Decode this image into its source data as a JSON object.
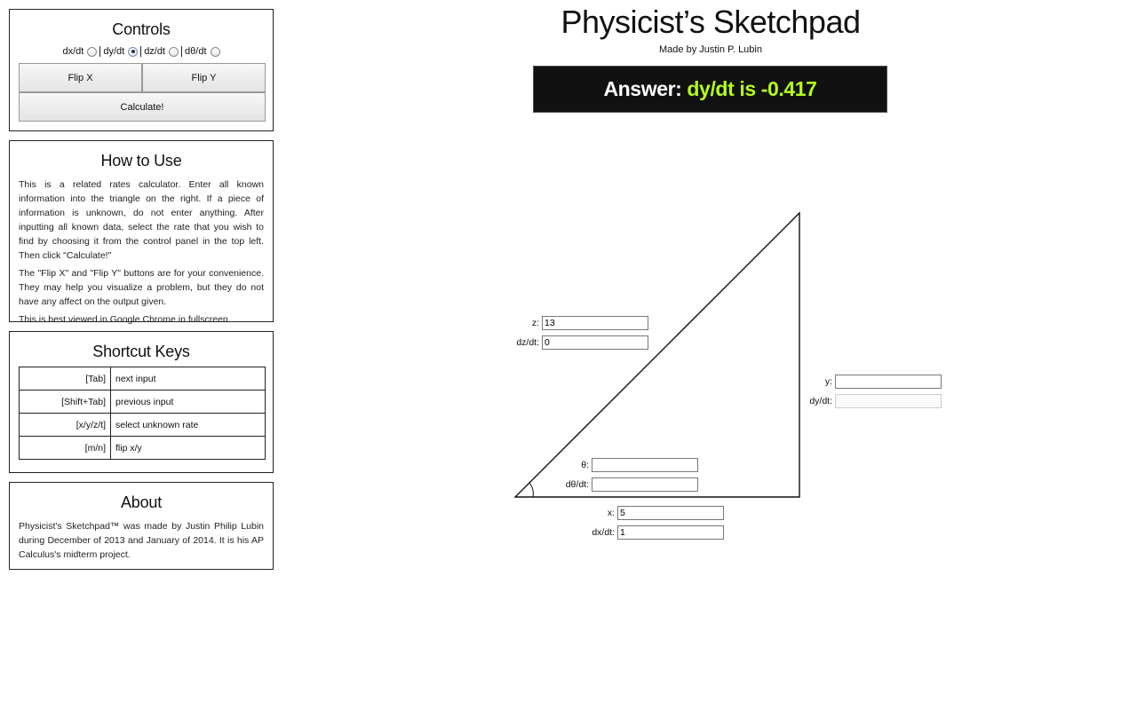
{
  "header": {
    "title": "Physicist’s Sketchpad",
    "subtitle": "Made by Justin P. Lubin"
  },
  "answer": {
    "label": "Answer:",
    "value": "dy/dt is -0.417"
  },
  "controls": {
    "title": "Controls",
    "rates": [
      {
        "label": "dx/dt",
        "selected": false
      },
      {
        "label": "dy/dt",
        "selected": true
      },
      {
        "label": "dz/dt",
        "selected": false
      },
      {
        "label": "dθ/dt",
        "selected": false
      }
    ],
    "flip_x_label": "Flip X",
    "flip_y_label": "Flip Y",
    "calculate_label": "Calculate!"
  },
  "how_to_use": {
    "title": "How to Use",
    "paragraphs": [
      "This is a related rates calculator. Enter all known information into the triangle on the right. If a piece of information is unknown, do not enter anything. After inputting all known data, select the rate that you wish to find by choosing it from the control panel in the top left. Then click \"Calculate!\"",
      "The \"Flip X\" and \"Flip Y\" buttons are for your convenience. They may help you visualize a problem, but they do not have any affect on the output given.",
      "This is best viewed in Google Chrome in fullscreen."
    ]
  },
  "shortcut_keys": {
    "title": "Shortcut Keys",
    "rows": [
      {
        "key": "[Tab]",
        "action": "next input"
      },
      {
        "key": "[Shift+Tab]",
        "action": "previous input"
      },
      {
        "key": "[x/y/z/t]",
        "action": "select unknown rate"
      },
      {
        "key": "[m/n]",
        "action": "flip x/y"
      }
    ]
  },
  "about": {
    "title": "About",
    "text": "Physicist's Sketchpad™ was made by Justin Philip Lubin during December of 2013 and January of 2014. It is his AP Calculus's midterm project."
  },
  "fields": {
    "z": {
      "label": "z:",
      "value": "13"
    },
    "dz": {
      "label": "dz/dt:",
      "value": "0"
    },
    "y": {
      "label": "y:",
      "value": ""
    },
    "dy": {
      "label": "dy/dt:",
      "value": ""
    },
    "theta": {
      "label": "θ:",
      "value": ""
    },
    "dtheta": {
      "label": "dθ/dt:",
      "value": ""
    },
    "x": {
      "label": "x:",
      "value": "5"
    },
    "dx": {
      "label": "dx/dt:",
      "value": "1"
    }
  }
}
